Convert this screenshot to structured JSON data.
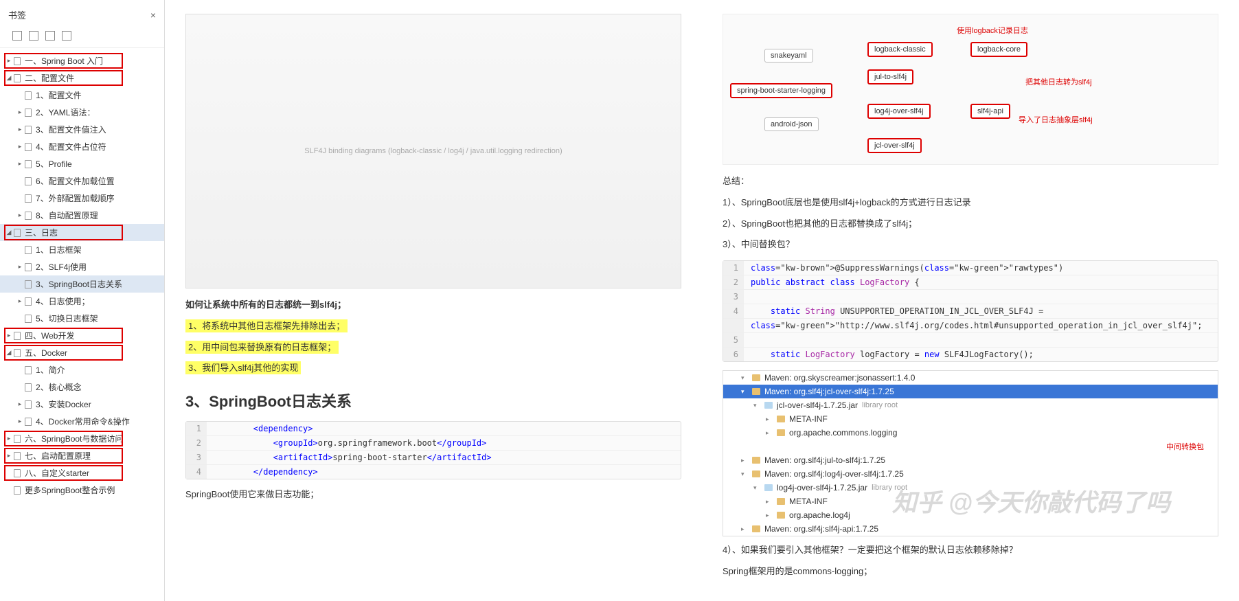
{
  "sidebar": {
    "title": "书签",
    "items": [
      {
        "label": "一、Spring Boot 入门",
        "indent": 0,
        "arrow": "▸",
        "boxed": true
      },
      {
        "label": "二、配置文件",
        "indent": 0,
        "arrow": "◢",
        "boxed": true
      },
      {
        "label": "1、配置文件",
        "indent": 1,
        "arrow": ""
      },
      {
        "label": "2、YAML语法：",
        "indent": 1,
        "arrow": "▸"
      },
      {
        "label": "3、配置文件值注入",
        "indent": 1,
        "arrow": "▸"
      },
      {
        "label": "4、配置文件占位符",
        "indent": 1,
        "arrow": "▸"
      },
      {
        "label": "5、Profile",
        "indent": 1,
        "arrow": "▸"
      },
      {
        "label": "6、配置文件加载位置",
        "indent": 1,
        "arrow": ""
      },
      {
        "label": "7、外部配置加载顺序",
        "indent": 1,
        "arrow": ""
      },
      {
        "label": "8、自动配置原理",
        "indent": 1,
        "arrow": "▸"
      },
      {
        "label": "三、日志",
        "indent": 0,
        "arrow": "◢",
        "boxed": true,
        "selected": true
      },
      {
        "label": "1、日志框架",
        "indent": 1,
        "arrow": ""
      },
      {
        "label": "2、SLF4j使用",
        "indent": 1,
        "arrow": "▸"
      },
      {
        "label": "3、SpringBoot日志关系",
        "indent": 1,
        "arrow": "",
        "selected": true
      },
      {
        "label": "4、日志使用；",
        "indent": 1,
        "arrow": "▸"
      },
      {
        "label": "5、切换日志框架",
        "indent": 1,
        "arrow": ""
      },
      {
        "label": "四、Web开发",
        "indent": 0,
        "arrow": "▸",
        "boxed": true
      },
      {
        "label": "五、Docker",
        "indent": 0,
        "arrow": "◢",
        "boxed": true
      },
      {
        "label": "1、简介",
        "indent": 1,
        "arrow": ""
      },
      {
        "label": "2、核心概念",
        "indent": 1,
        "arrow": ""
      },
      {
        "label": "3、安装Docker",
        "indent": 1,
        "arrow": "▸"
      },
      {
        "label": "4、Docker常用命令&操作",
        "indent": 1,
        "arrow": "▸"
      },
      {
        "label": "六、SpringBoot与数据访问",
        "indent": 0,
        "arrow": "▸",
        "boxed": true
      },
      {
        "label": "七、启动配置原理",
        "indent": 0,
        "arrow": "▸",
        "boxed": true
      },
      {
        "label": "八、自定义starter",
        "indent": 0,
        "arrow": "",
        "boxed": true
      },
      {
        "label": "更多SpringBoot整合示例",
        "indent": 0,
        "arrow": ""
      }
    ]
  },
  "left_col": {
    "diagram_text": "SLF4J binding diagrams (logback-classic / log4j / java.util.logging redirection)",
    "intro": "如何让系统中所有的日志都统一到slf4j；",
    "hl1": "1、将系统中其他日志框架先排除出去；",
    "hl2": "2、用中间包来替换原有的日志框架；",
    "hl3": "3、我们导入slf4j其他的实现",
    "heading": "3、SpringBoot日志关系",
    "footer": "SpringBoot使用它来做日志功能；",
    "code": [
      "        <dependency>",
      "            <groupId>org.springframework.boot</groupId>",
      "            <artifactId>spring-boot-starter</artifactId>",
      "        </dependency>"
    ]
  },
  "right_col": {
    "mindmap": {
      "root": "spring-boot-starter-logging",
      "nodes": [
        "snakeyaml",
        "android-json",
        "logback-classic",
        "logback-core",
        "jul-to-slf4j",
        "log4j-over-slf4j",
        "jcl-over-slf4j",
        "slf4j-api"
      ],
      "label1": "使用logback记录日志",
      "label2": "把其他日志转为slf4j",
      "label3": "导入了日志抽象层slf4j"
    },
    "summary_title": "总结：",
    "p1": "1）、SpringBoot底层也是使用slf4j+logback的方式进行日志记录",
    "p2": "2）、SpringBoot也把其他的日志都替换成了slf4j；",
    "p3": "3）、中间替换包？",
    "code2": [
      {
        "n": "1",
        "t": "@SuppressWarnings(\"rawtypes\")"
      },
      {
        "n": "2",
        "t": "public abstract class LogFactory {"
      },
      {
        "n": "3",
        "t": ""
      },
      {
        "n": "4",
        "t": "    static String UNSUPPORTED_OPERATION_IN_JCL_OVER_SLF4J ="
      },
      {
        "n": "",
        "t": "\"http://www.slf4j.org/codes.html#unsupported_operation_in_jcl_over_slf4j\";"
      },
      {
        "n": "5",
        "t": ""
      },
      {
        "n": "6",
        "t": "    static LogFactory logFactory = new SLF4JLogFactory();"
      }
    ],
    "filetree": {
      "callout": "中间转换包",
      "items": [
        {
          "indent": 1,
          "arrow": "▾",
          "icon": "folder",
          "label": "Maven: org.skyscreamer:jsonassert:1.4.0"
        },
        {
          "indent": 1,
          "arrow": "▾",
          "icon": "folder",
          "label": "Maven: org.slf4j:jcl-over-slf4j:1.7.25",
          "sel": true
        },
        {
          "indent": 2,
          "arrow": "▾",
          "icon": "jar",
          "label": "jcl-over-slf4j-1.7.25.jar",
          "lib": true
        },
        {
          "indent": 3,
          "arrow": "▸",
          "icon": "folder",
          "label": "META-INF"
        },
        {
          "indent": 3,
          "arrow": "▸",
          "icon": "folder",
          "label": "org.apache.commons.logging"
        },
        {
          "indent": 1,
          "arrow": "▸",
          "icon": "folder",
          "label": "Maven: org.slf4j:jul-to-slf4j:1.7.25"
        },
        {
          "indent": 1,
          "arrow": "▾",
          "icon": "folder",
          "label": "Maven: org.slf4j:log4j-over-slf4j:1.7.25"
        },
        {
          "indent": 2,
          "arrow": "▾",
          "icon": "jar",
          "label": "log4j-over-slf4j-1.7.25.jar",
          "lib": true
        },
        {
          "indent": 3,
          "arrow": "▸",
          "icon": "folder",
          "label": "META-INF"
        },
        {
          "indent": 3,
          "arrow": "▸",
          "icon": "folder",
          "label": "org.apache.log4j"
        },
        {
          "indent": 1,
          "arrow": "▸",
          "icon": "folder",
          "label": "Maven: org.slf4j:slf4j-api:1.7.25"
        }
      ]
    },
    "p4": "4）、如果我们要引入其他框架？一定要把这个框架的默认日志依赖移除掉？",
    "p5": "Spring框架用的是commons-logging；"
  },
  "watermark": "知乎 @今天你敲代码了吗"
}
